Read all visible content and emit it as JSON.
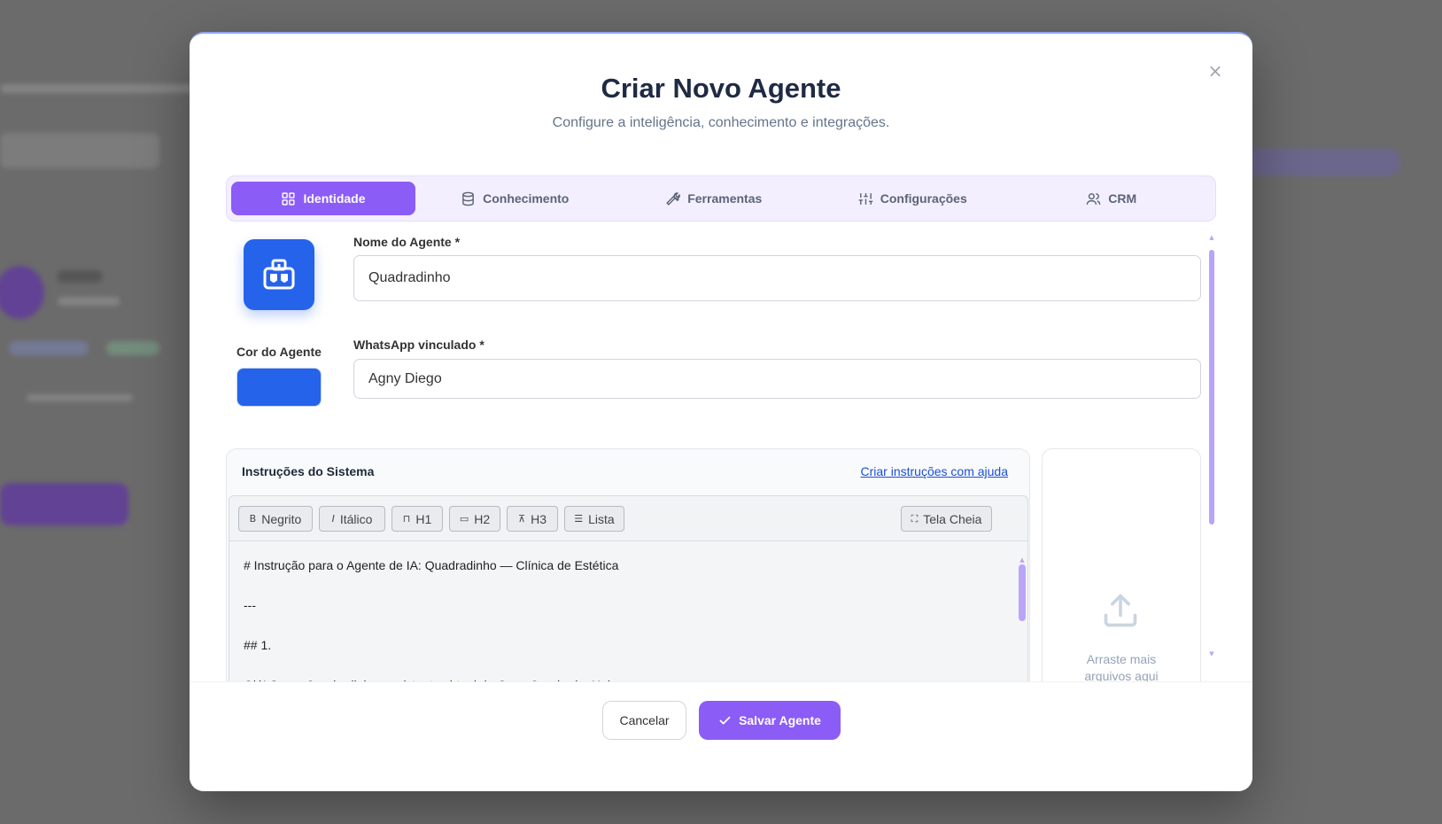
{
  "modal": {
    "title": "Criar Novo Agente",
    "subtitle": "Configure a inteligência, conhecimento e integrações.",
    "close_icon": "×"
  },
  "tabs": [
    {
      "label": "Identidade",
      "icon": "grid-icon",
      "active": true
    },
    {
      "label": "Conhecimento",
      "icon": "database-icon",
      "active": false
    },
    {
      "label": "Ferramentas",
      "icon": "wrench-icon",
      "active": false
    },
    {
      "label": "Configurações",
      "icon": "sliders-icon",
      "active": false
    },
    {
      "label": "CRM",
      "icon": "users-icon",
      "active": false
    }
  ],
  "identity": {
    "agent_color_label": "Cor do Agente",
    "agent_color": "#2563eb",
    "agent_name_label": "Nome do Agente *",
    "agent_name_value": "Quadradinho",
    "whatsapp_label": "WhatsApp vinculado *",
    "whatsapp_value": "Agny Diego"
  },
  "instructions": {
    "title": "Instruções do Sistema",
    "help_link": "Criar instruções com ajuda",
    "toolbar": {
      "bold": "Negrito",
      "italic": "Itálico",
      "h1": "H1",
      "h2": "H2",
      "h3": "H3",
      "list": "Lista",
      "fullscreen": "Tela Cheia"
    },
    "lines": [
      "# Instrução para o Agente de IA: Quadradinho — Clínica de Estética",
      "---",
      "## 1.",
      "Olá! Sou o Quadradinho, assistente virtual da Casa Quadrada. Hoje"
    ]
  },
  "upload": {
    "text_line1": "Arraste mais",
    "text_line2": "arquivos aqui"
  },
  "footer": {
    "cancel_label": "Cancelar",
    "save_label": "Salvar Agente"
  },
  "colors": {
    "accent": "#8b5cf6",
    "agent_blue": "#2563eb"
  }
}
